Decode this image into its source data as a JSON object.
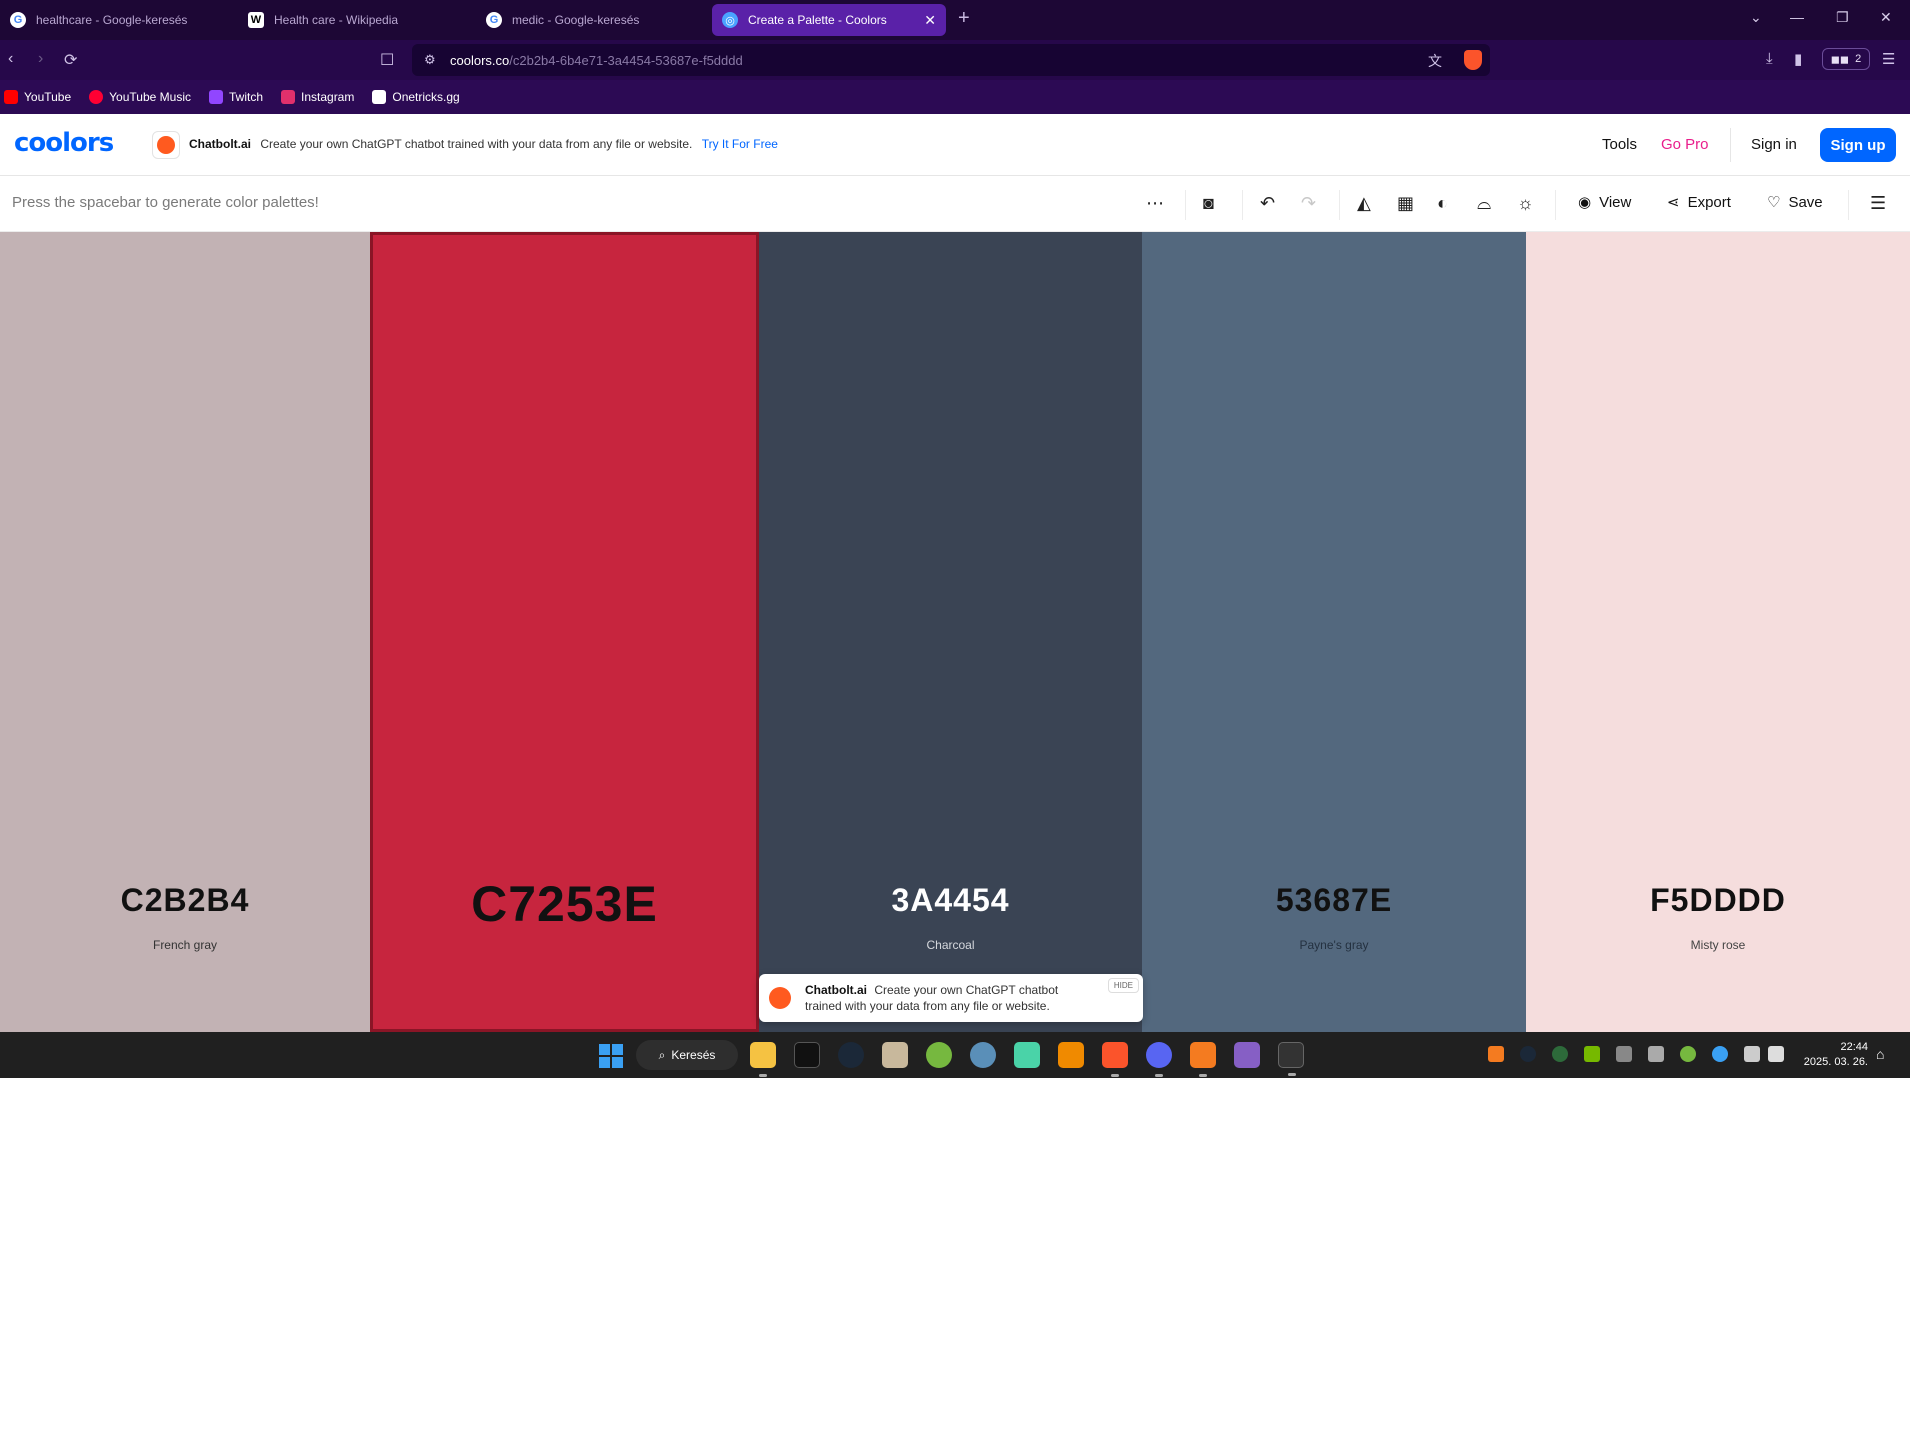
{
  "browser": {
    "tabs": [
      {
        "title": "healthcare - Google-keresés",
        "icon": "google-icon"
      },
      {
        "title": "Health care - Wikipedia",
        "icon": "wikipedia-icon"
      },
      {
        "title": "medic - Google-keresés",
        "icon": "google-icon"
      },
      {
        "title": "Create a Palette - Coolors",
        "icon": "coolors-icon",
        "active": true
      }
    ],
    "url_domain": "coolors.co",
    "url_path": "/c2b2b4-6b4e71-3a4454-53687e-f5dddd",
    "vpn_count": "2",
    "bookmarks": [
      {
        "label": "YouTube",
        "color": "#ff0000"
      },
      {
        "label": "YouTube Music",
        "color": "#ff0033"
      },
      {
        "label": "Twitch",
        "color": "#9146ff"
      },
      {
        "label": "Instagram",
        "color": "#e1306c"
      },
      {
        "label": "Onetricks.gg",
        "color": "#ffffff"
      }
    ]
  },
  "site": {
    "logo": "coolors",
    "ad": {
      "brand": "Chatbolt.ai",
      "text": "Create your own ChatGPT chatbot trained with your data from any file or website.",
      "cta": "Try It For Free"
    },
    "nav": {
      "tools": "Tools",
      "go_pro": "Go Pro",
      "sign_in": "Sign in",
      "sign_up": "Sign up"
    },
    "toolbar": {
      "hint": "Press the spacebar to generate color palettes!",
      "view": "View",
      "export": "Export",
      "save": "Save"
    }
  },
  "palette": {
    "colors": [
      {
        "hex": "C2B2B4",
        "name": "French gray",
        "bg": "#c2b2b4",
        "fg": "#111111",
        "name_fg": "#333333"
      },
      {
        "hex": "C7253E",
        "name": "",
        "bg": "#c7253e",
        "fg": "#111111",
        "name_fg": "#333333"
      },
      {
        "hex": "3A4454",
        "name": "Charcoal",
        "bg": "#3a4454",
        "fg": "#ffffff",
        "name_fg": "#d5d8dd"
      },
      {
        "hex": "53687E",
        "name": "Payne's gray",
        "bg": "#53687e",
        "fg": "#111111",
        "name_fg": "#243140"
      },
      {
        "hex": "F5DDDD",
        "name": "Misty rose",
        "bg": "#f5dddd",
        "fg": "#111111",
        "name_fg": "#444444"
      }
    ]
  },
  "popup": {
    "brand": "Chatbolt.ai",
    "text": "Create your own ChatGPT chatbot trained with your data from any file or website.",
    "hide": "HIDE"
  },
  "taskbar": {
    "search": "Keresés",
    "time": "22:44",
    "date": "2025. 03. 26."
  }
}
